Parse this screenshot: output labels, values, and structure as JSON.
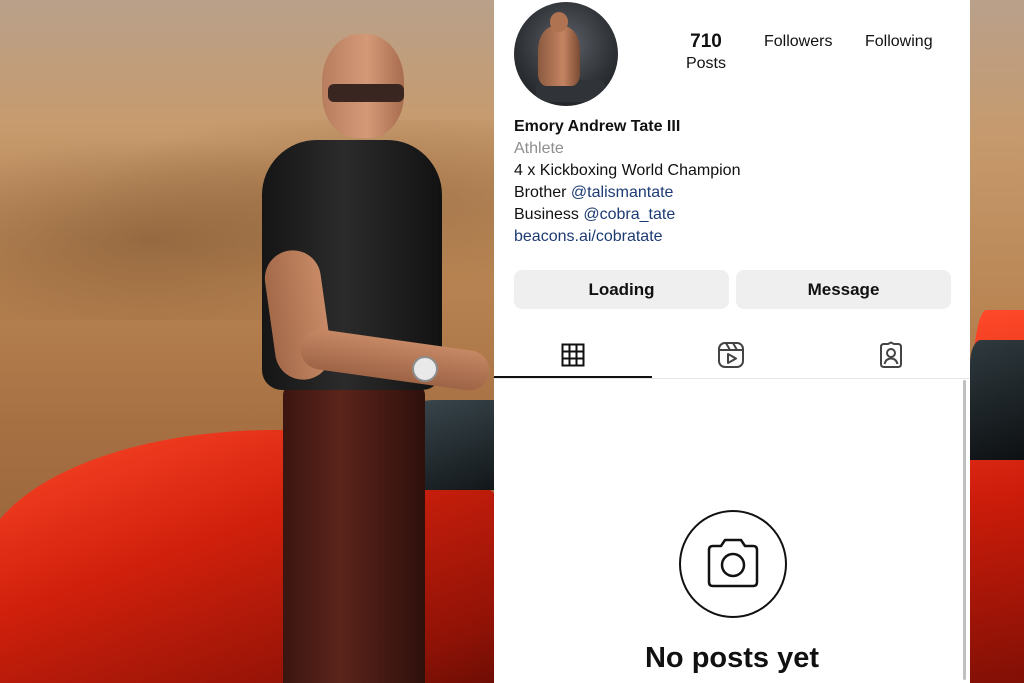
{
  "profile": {
    "stats": {
      "posts_count": "710",
      "posts_label": "Posts",
      "followers_label": "Followers",
      "following_label": "Following"
    },
    "bio": {
      "name": "Emory Andrew Tate III",
      "category": "Athlete",
      "line1": "4 x Kickboxing World Champion",
      "line2_prefix": "Brother",
      "line2_handle": "@talismantate",
      "line3_prefix": "Business",
      "line3_handle": "@cobra_tate",
      "website": "beacons.ai/cobratate"
    },
    "buttons": {
      "primary": "Loading",
      "message": "Message"
    },
    "tabs": [
      {
        "icon": "grid-icon",
        "active": true
      },
      {
        "icon": "reels-icon",
        "active": false
      },
      {
        "icon": "tagged-icon",
        "active": false
      }
    ],
    "empty_state": {
      "icon": "camera-icon",
      "title": "No posts yet"
    },
    "colors": {
      "link": "#1d3b73",
      "secondary_text": "#8e8e8e",
      "button_bg": "#efefef"
    }
  }
}
